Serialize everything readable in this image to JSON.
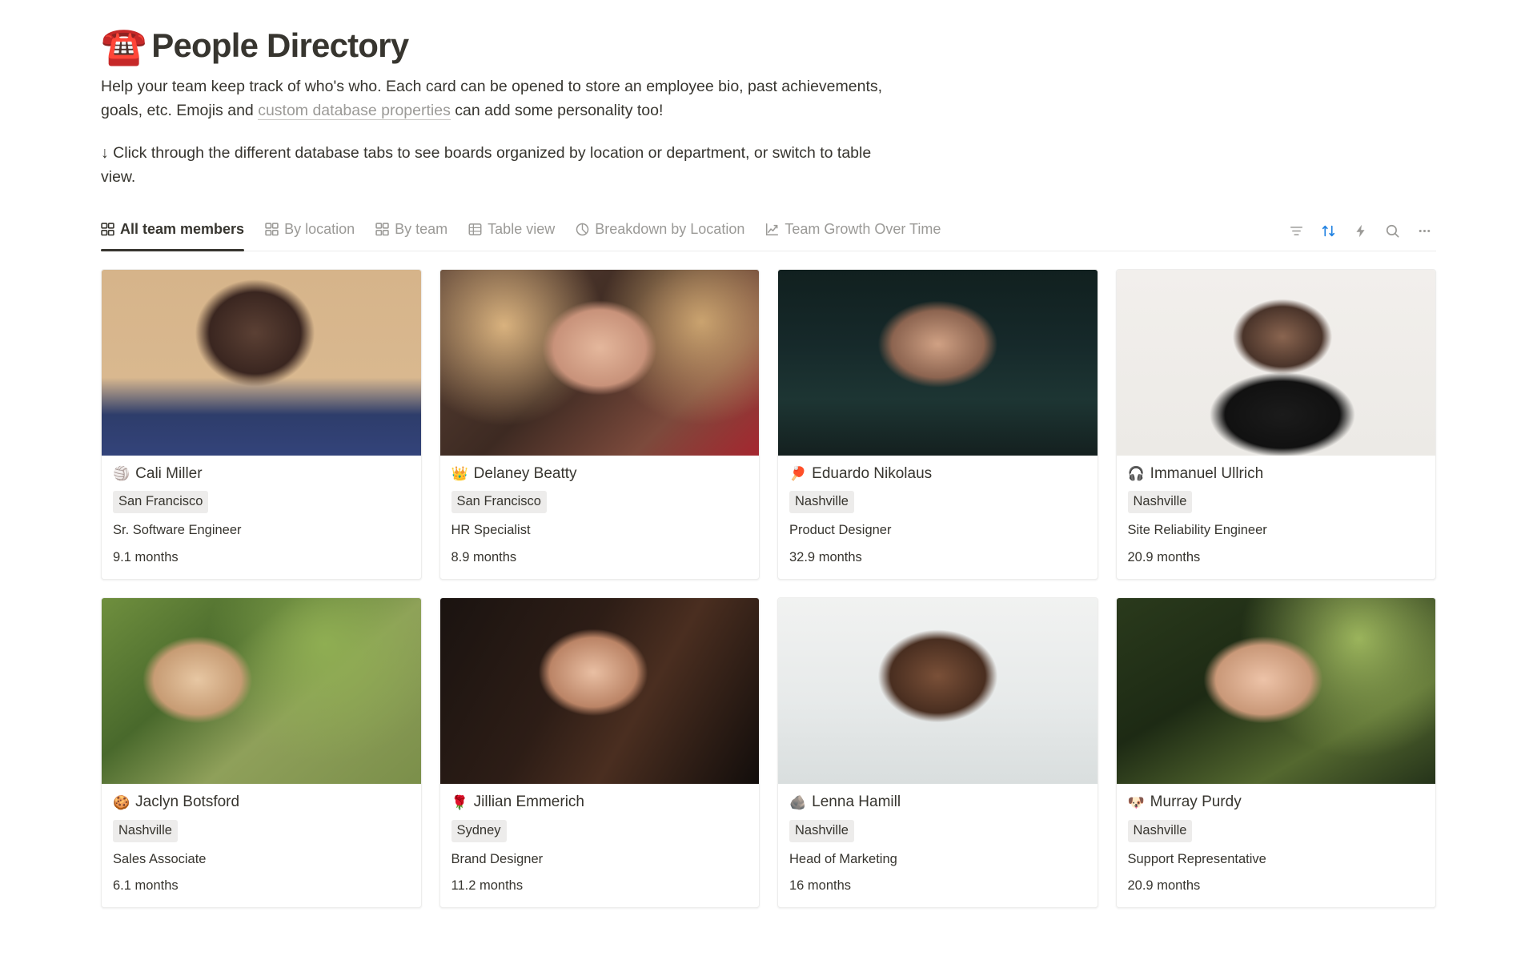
{
  "header": {
    "emoji": "☎️",
    "emoji_name": "telephone-icon",
    "title": "People Directory",
    "description_part1": "Help your team keep track of who's who. Each card can be opened to store an employee bio, past achievements, goals, etc. Emojis and ",
    "description_link": "custom database properties",
    "description_part2": " can add some personality too!",
    "description_line2": "↓ Click through the different database tabs to see boards organized by location or department, or switch to table view."
  },
  "tabs": [
    {
      "label": "All team members",
      "icon": "board-grid-icon",
      "active": true
    },
    {
      "label": "By location",
      "icon": "board-grid-icon",
      "active": false
    },
    {
      "label": "By team",
      "icon": "board-grid-icon",
      "active": false
    },
    {
      "label": "Table view",
      "icon": "table-icon",
      "active": false
    },
    {
      "label": "Breakdown by Location",
      "icon": "pie-chart-icon",
      "active": false
    },
    {
      "label": "Team Growth Over Time",
      "icon": "line-chart-icon",
      "active": false
    }
  ],
  "toolbar": {
    "filter": "filter-icon",
    "sort": "sort-icon",
    "automation": "lightning-icon",
    "search": "search-icon",
    "more": "more-options-icon",
    "accent_color": "#2383e2",
    "muted_color": "#9b9a97"
  },
  "cards": [
    {
      "emoji": "🏐",
      "emoji_name": "volleyball-icon",
      "name": "Cali Miller",
      "location": "San Francisco",
      "role": "Sr. Software Engineer",
      "tenure": "9.1 months"
    },
    {
      "emoji": "👑",
      "emoji_name": "crown-icon",
      "name": "Delaney Beatty",
      "location": "San Francisco",
      "role": "HR Specialist",
      "tenure": "8.9 months"
    },
    {
      "emoji": "🏓",
      "emoji_name": "ping-pong-icon",
      "name": "Eduardo Nikolaus",
      "location": "Nashville",
      "role": "Product Designer",
      "tenure": "32.9 months"
    },
    {
      "emoji": "🎧",
      "emoji_name": "headphones-icon",
      "name": "Immanuel Ullrich",
      "location": "Nashville",
      "role": "Site Reliability Engineer",
      "tenure": "20.9 months"
    },
    {
      "emoji": "🍪",
      "emoji_name": "cookie-icon",
      "name": "Jaclyn Botsford",
      "location": "Nashville",
      "role": "Sales Associate",
      "tenure": "6.1 months"
    },
    {
      "emoji": "🌹",
      "emoji_name": "rose-icon",
      "name": "Jillian Emmerich",
      "location": "Sydney",
      "role": "Brand Designer",
      "tenure": "11.2 months"
    },
    {
      "emoji": "🪨",
      "emoji_name": "rock-icon",
      "name": "Lenna Hamill",
      "location": "Nashville",
      "role": "Head of Marketing",
      "tenure": "16 months"
    },
    {
      "emoji": "🐶",
      "emoji_name": "dog-face-icon",
      "name": "Murray Purdy",
      "location": "Nashville",
      "role": "Support Representative",
      "tenure": "20.9 months"
    }
  ]
}
